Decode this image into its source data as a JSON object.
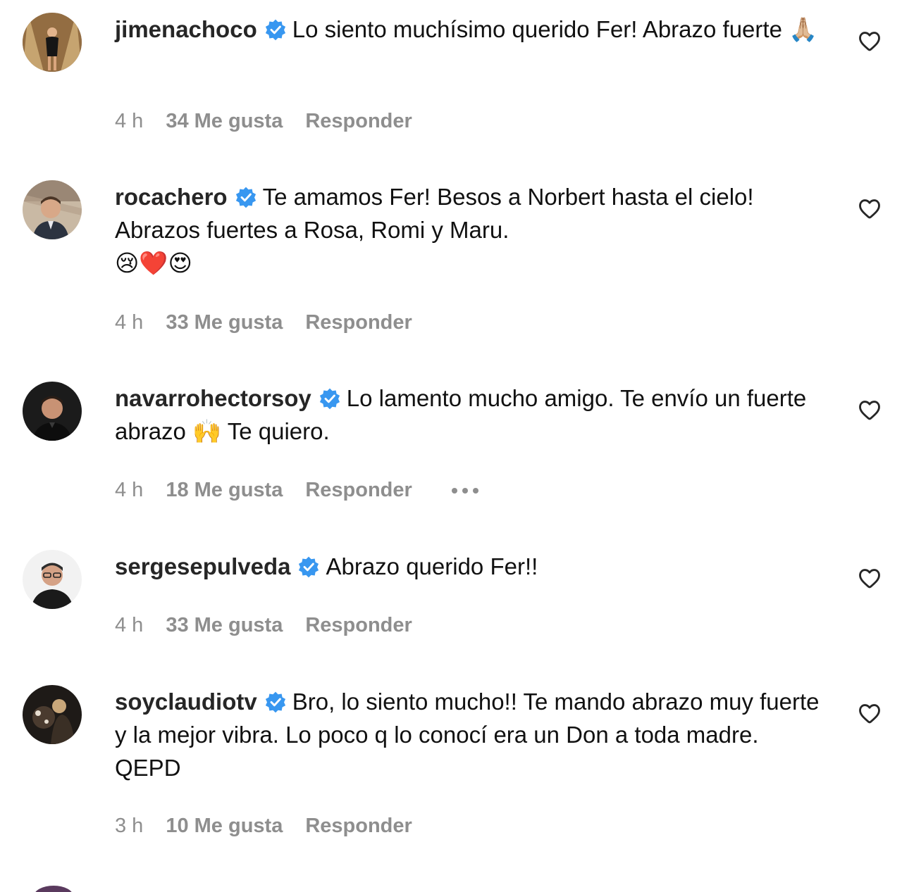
{
  "comments": [
    {
      "username": "jimenachoco",
      "verified": true,
      "text": "Lo siento muchísimo querido Fer! Abrazo fuerte 🙏🏼",
      "time": "4 h",
      "likes": "34 Me gusta",
      "reply": "Responder"
    },
    {
      "username": "rocachero",
      "verified": true,
      "text": "Te amamos Fer! Besos a Norbert hasta el cielo! Abrazos fuertes a Rosa, Romi y Maru.",
      "text_emoji_line": "😢❤️😍",
      "time": "4 h",
      "likes": "33 Me gusta",
      "reply": "Responder"
    },
    {
      "username": "navarrohectorsoy",
      "verified": true,
      "text": "Lo lamento mucho amigo. Te envío un fuerte abrazo 🙌 Te quiero.",
      "time": "4 h",
      "likes": "18 Me gusta",
      "reply": "Responder",
      "more_icon": "ellipsis-icon"
    },
    {
      "username": "sergesepulveda",
      "verified": true,
      "text": "Abrazo querido Fer!!",
      "time": "4 h",
      "likes": "33 Me gusta",
      "reply": "Responder"
    },
    {
      "username": "soyclaudiotv",
      "verified": true,
      "text": "Bro, lo siento mucho!! Te mando abrazo muy fuerte y la mejor vibra. Lo poco q lo conocí era un Don a toda madre. QEPD",
      "time": "3 h",
      "likes": "10 Me gusta",
      "reply": "Responder"
    }
  ],
  "icons": {
    "verified": "verified-badge-icon",
    "like": "heart-outline-icon"
  },
  "colors": {
    "verified_blue": "#3897f0",
    "meta_gray": "#8e8e8e",
    "text": "#111111"
  }
}
